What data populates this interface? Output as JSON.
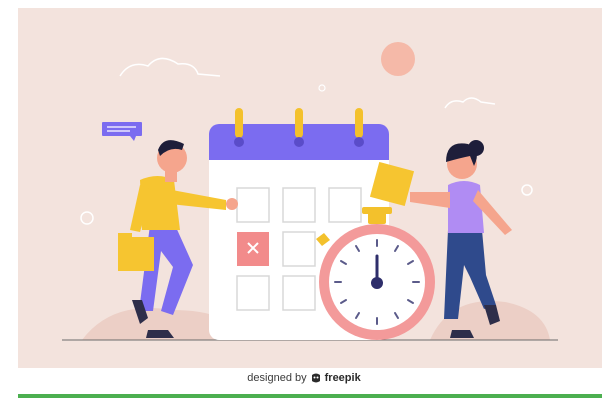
{
  "colors": {
    "background": "#f3e3dd",
    "calendar_header": "#7b6cf0",
    "calendar_body": "#ffffff",
    "ring": "#f3c12c",
    "accent_pink": "#f28b8b",
    "stopwatch_rim": "#f39a9a",
    "man_shirt": "#f6c530",
    "man_pants": "#7b6cf0",
    "woman_shirt": "#b08cf3",
    "woman_pants": "#2f4a8c",
    "folder": "#f6c530",
    "ground": "#eccfc6",
    "green_bar": "#4caf50"
  },
  "icons": {
    "calendar": "calendar-icon",
    "stopwatch": "stopwatch-icon",
    "chat": "chat-bubble-icon",
    "x_mark": "x-mark-icon",
    "freepik_logo": "freepik-logo-icon"
  },
  "credit": {
    "prefix": "designed by",
    "brand": "freepik"
  }
}
